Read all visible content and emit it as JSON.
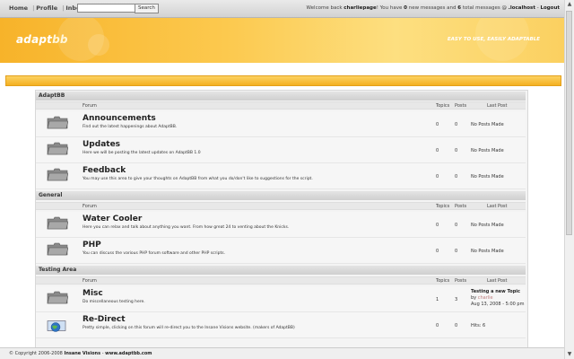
{
  "topbar": {
    "home": "Home",
    "profile": "Profile",
    "inbox": "Inbox",
    "search_value": "",
    "search_button": "Search",
    "welcome_prefix": "Welcome back",
    "username": "charliepage",
    "message_part1": "! You have",
    "new_count": "0",
    "message_part2": "new messages and",
    "total_count": "6",
    "message_part3": "total messages @",
    "host": ".localhost",
    "logout": "Logout"
  },
  "banner": {
    "logo_main": "adapt",
    "logo_bb": "bb",
    "tagline": "EASY TO USE, EASILY ADAPTABLE"
  },
  "columns": {
    "forum": "Forum",
    "topics": "Topics",
    "posts": "Posts",
    "last_post": "Last Post"
  },
  "categories": [
    {
      "name": "AdaptBB",
      "forums": [
        {
          "name": "Announcements",
          "desc": "Find out the latest happenings about AdaptBB.",
          "topics": "0",
          "posts": "0",
          "last_post": "No Posts Made"
        },
        {
          "name": "Updates",
          "desc": "Here we will be posting the latest updates on AdaptBB 1.0",
          "topics": "0",
          "posts": "0",
          "last_post": "No Posts Made"
        },
        {
          "name": "Feedback",
          "desc": "You may use this area to give your thoughts on AdaptBB from what you do/don't like to suggestions for the script.",
          "topics": "0",
          "posts": "0",
          "last_post": "No Posts Made"
        }
      ]
    },
    {
      "name": "General",
      "forums": [
        {
          "name": "Water Cooler",
          "desc": "Here you can relax and talk about anything you want. From how great 24 to venting about the Knicks.",
          "topics": "0",
          "posts": "0",
          "last_post": "No Posts Made"
        },
        {
          "name": "PHP",
          "desc": "You can discuss the various PHP forum software and other PHP scripts.",
          "topics": "0",
          "posts": "0",
          "last_post": "No Posts Made"
        }
      ]
    },
    {
      "name": "Testing Area",
      "forums": [
        {
          "name": "Misc",
          "desc": "Do miscellaneous testing here.",
          "topics": "1",
          "posts": "3",
          "last_post_title": "Testing a new Topic",
          "last_post_by_label": "by",
          "last_post_by": "charlie",
          "last_post_date": "Aug 13, 2008 - 5:00 pm"
        },
        {
          "name": "Re-Direct",
          "desc": "Pretty simple, clicking on this forum will re-direct you to the Insane Visions website. (makers of AdaptBB)",
          "topics": "0",
          "posts": "0",
          "last_post": "Hits: 6"
        }
      ]
    }
  ],
  "footer": {
    "prefix": "© Copyright 2006-2008",
    "company": "Insane Visions",
    "dash": "-",
    "site": "www.adaptbb.com"
  },
  "colors": {
    "banner": "#f7b32a",
    "accent": "#e39f1a"
  }
}
